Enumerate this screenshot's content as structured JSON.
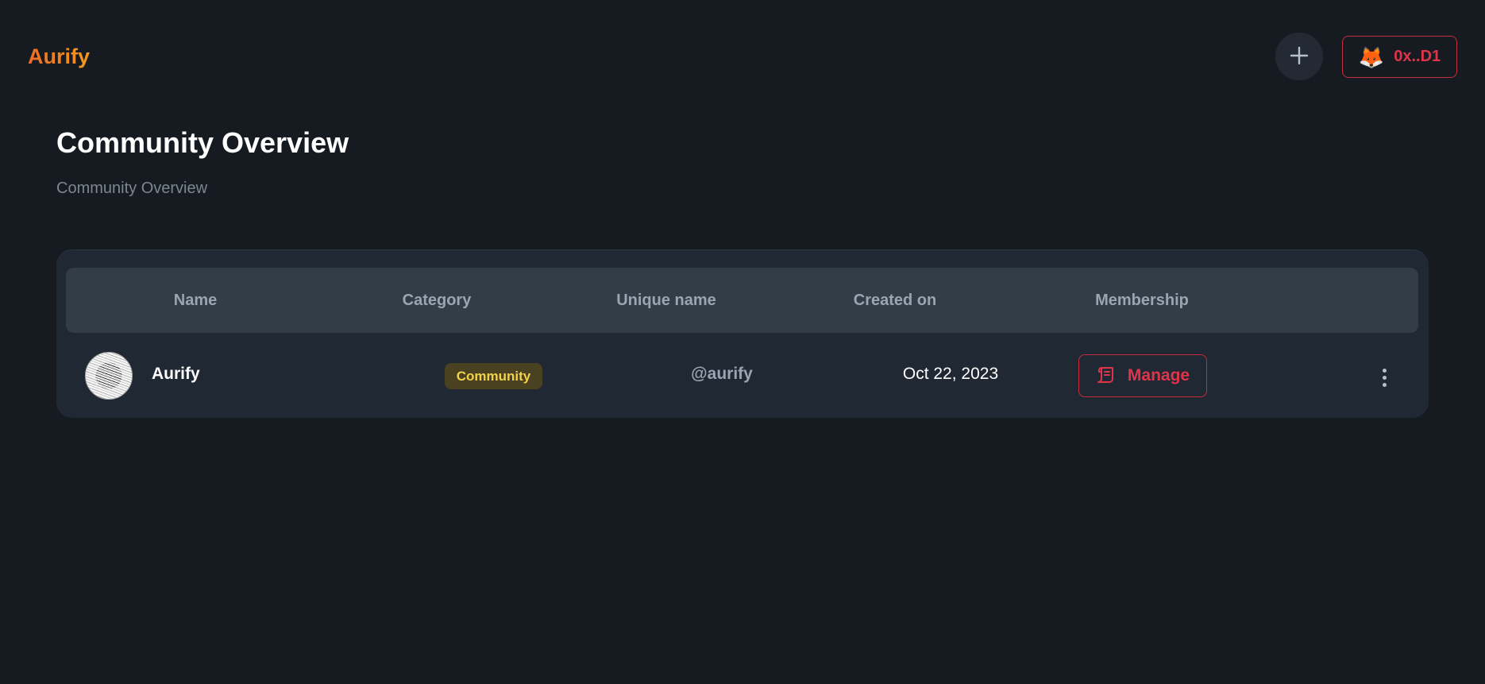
{
  "app": {
    "brand": "Aurify"
  },
  "header": {
    "add_icon": "plus-icon",
    "wallet": {
      "icon": "fox-icon",
      "address": "0x..D1"
    }
  },
  "page": {
    "title": "Community Overview",
    "subtitle": "Community Overview"
  },
  "table": {
    "columns": [
      "Name",
      "Category",
      "Unique name",
      "Created on",
      "Membership"
    ],
    "rows": [
      {
        "name": "Aurify",
        "category": "Community",
        "unique_name": "@aurify",
        "created_on": "Oct 22, 2023",
        "membership_action": "Manage",
        "membership_icon": "scroll-icon",
        "more_icon": "more-vertical-icon"
      }
    ]
  },
  "colors": {
    "background": "#161b22",
    "card": "#202833",
    "table_header": "#333d48",
    "accent_red": "#e0344a",
    "brand_orange": "#f26b21",
    "badge_bg": "#4a4120",
    "badge_text": "#f1d24b"
  }
}
